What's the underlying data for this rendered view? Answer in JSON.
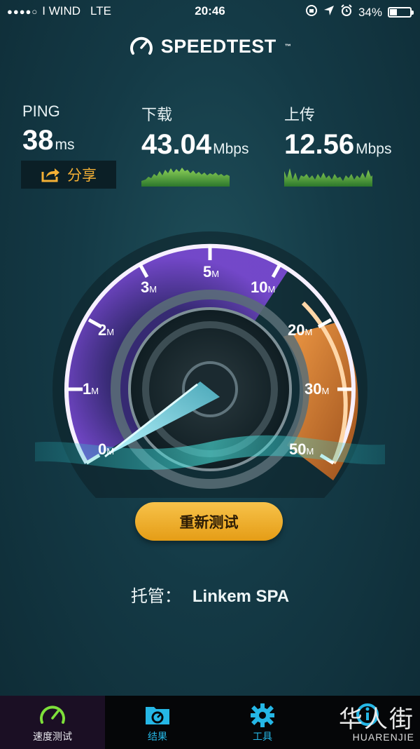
{
  "status_bar": {
    "signal": "●●●●○",
    "carrier": "I WIND",
    "network": "LTE",
    "time": "20:46",
    "battery_percent": "34%",
    "battery_level": 0.34,
    "icons": [
      "rotation-lock-icon",
      "location-icon",
      "alarm-icon",
      "battery-icon"
    ]
  },
  "header": {
    "title": "SPEEDTEST",
    "trademark": "™",
    "icon": "speedometer-icon"
  },
  "results": {
    "ping": {
      "label": "PING",
      "value": "38",
      "unit": "ms"
    },
    "download": {
      "label": "下载",
      "value": "43.04",
      "unit": "Mbps"
    },
    "upload": {
      "label": "上传",
      "value": "12.56",
      "unit": "Mbps"
    },
    "share_label": "分享"
  },
  "gauge": {
    "ticks": [
      {
        "num": "0",
        "unit": "M"
      },
      {
        "num": "1",
        "unit": "M"
      },
      {
        "num": "2",
        "unit": "M"
      },
      {
        "num": "3",
        "unit": "M"
      },
      {
        "num": "5",
        "unit": "M"
      },
      {
        "num": "10",
        "unit": "M"
      },
      {
        "num": "20",
        "unit": "M"
      },
      {
        "num": "30",
        "unit": "M"
      },
      {
        "num": "50",
        "unit": "M"
      }
    ],
    "needle_value_mbps": 0,
    "colors": {
      "purple": "#7b3fd6",
      "orange": "#e77a2a",
      "teal": "#3fd1d8"
    }
  },
  "retest_label": "重新测试",
  "host": {
    "label": "托管：",
    "name": "Linkem SPA"
  },
  "tabs": [
    {
      "label": "速度测试",
      "icon": "gauge-icon",
      "active": true
    },
    {
      "label": "结果",
      "icon": "results-folder-icon",
      "active": false
    },
    {
      "label": "工具",
      "icon": "gear-icon",
      "active": false
    },
    {
      "label": "",
      "icon": "info-icon",
      "active": false
    }
  ],
  "watermark": {
    "main": "华人街",
    "sub": "HUARENJIE"
  }
}
